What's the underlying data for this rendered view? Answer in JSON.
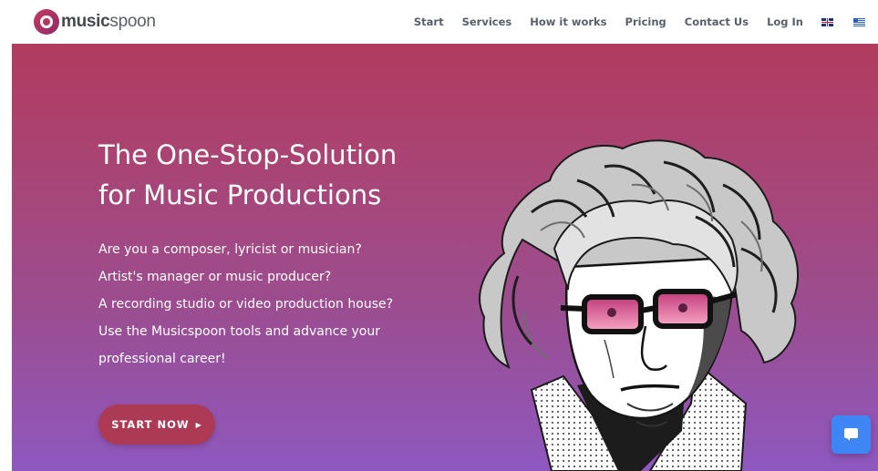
{
  "brand": {
    "name_bold": "music",
    "name_light": "spoon",
    "primary_color": "#b23b5f",
    "gradient_end_color": "#8e58c0"
  },
  "nav": {
    "links": [
      "Start",
      "Services",
      "How it works",
      "Pricing",
      "Contact Us",
      "Log In"
    ],
    "languages": [
      "uk-flag-icon",
      "greek-flag-icon"
    ]
  },
  "hero": {
    "headline_line1": "The One-Stop-Solution",
    "headline_line2": "for Music Productions",
    "lines": [
      "Are you a composer, lyricist or musician?",
      "Artist's manager or music producer?",
      "A recording studio or video production house?",
      "Use the Musicspoon tools and advance your",
      "professional career!"
    ],
    "cta_label": "START NOW",
    "cta_icon": "triangle-right-icon",
    "illustration": "beethoven-with-pink-sunglasses-illustration"
  },
  "chat_widget": {
    "icon": "chat-bubble-icon",
    "color": "#3d86f3"
  }
}
